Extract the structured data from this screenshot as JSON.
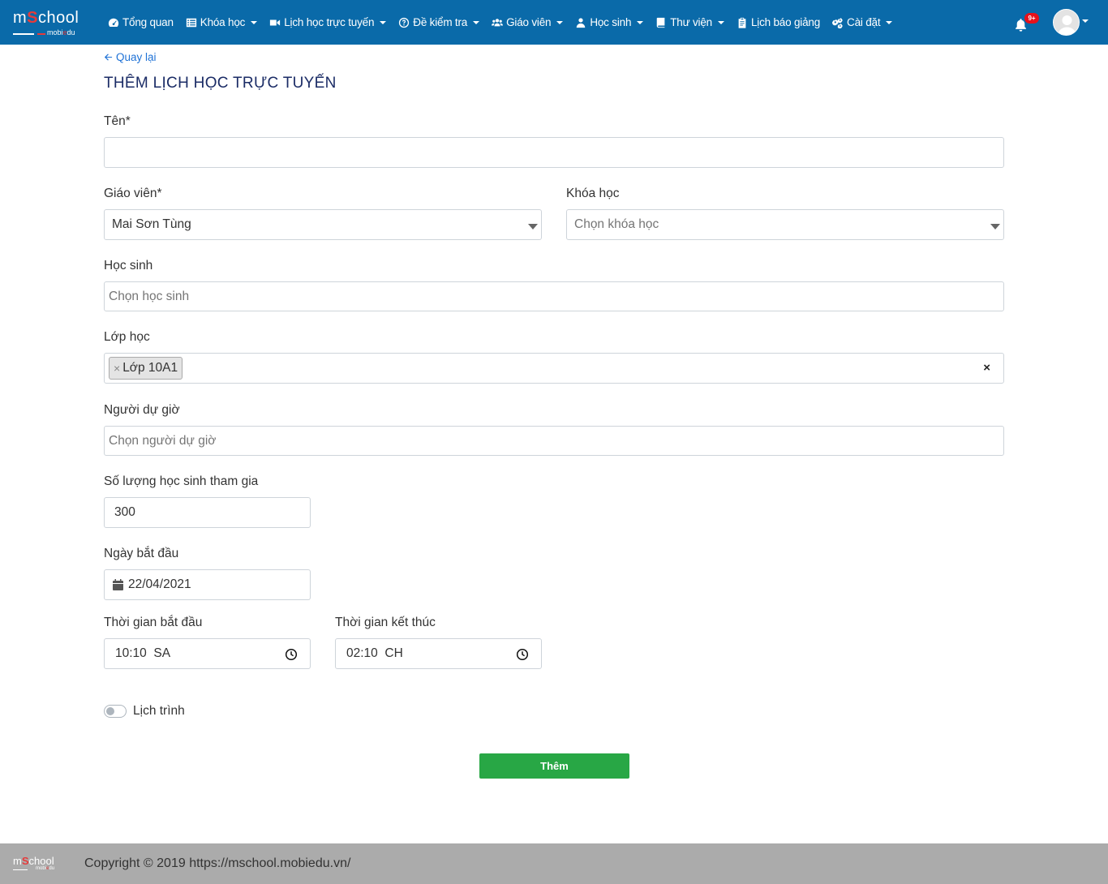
{
  "nav": {
    "logo": {
      "pre": "m",
      "s": "S",
      "post": "chool",
      "sub_pre": "mobi",
      "sub_post": "du"
    },
    "items": [
      {
        "label": "Tổng quan",
        "icon": "dashboard-icon",
        "dropdown": false
      },
      {
        "label": "Khóa học",
        "icon": "list-icon",
        "dropdown": true
      },
      {
        "label": "Lịch học trực tuyến",
        "icon": "video-icon",
        "dropdown": true
      },
      {
        "label": "Đề kiểm tra",
        "icon": "question-circle-icon",
        "dropdown": true
      },
      {
        "label": "Giáo viên",
        "icon": "users-icon",
        "dropdown": true
      },
      {
        "label": "Học sinh",
        "icon": "user-icon",
        "dropdown": true
      },
      {
        "label": "Thư viện",
        "icon": "book-icon",
        "dropdown": true
      },
      {
        "label": "Lịch báo giảng",
        "icon": "clipboard-icon",
        "dropdown": false
      },
      {
        "label": "Cài đặt",
        "icon": "gears-icon",
        "dropdown": true
      }
    ],
    "notification_badge": "9+"
  },
  "page": {
    "back_label": "Quay lại",
    "title": "THÊM LỊCH HỌC TRỰC TUYẾN"
  },
  "form": {
    "name": {
      "label": "Tên*",
      "value": ""
    },
    "teacher": {
      "label": "Giáo viên*",
      "value": "Mai Sơn Tùng"
    },
    "course": {
      "label": "Khóa học",
      "placeholder": "Chọn khóa học"
    },
    "student": {
      "label": "Học sinh",
      "placeholder": "Chọn học sinh"
    },
    "class": {
      "label": "Lớp học",
      "tags": [
        "Lớp 10A1"
      ],
      "tag_remove": "×",
      "clear": "×"
    },
    "observer": {
      "label": "Người dự giờ",
      "placeholder": "Chọn người dự giờ"
    },
    "count": {
      "label": "Số lượng học sinh tham gia",
      "value": "300"
    },
    "start_date": {
      "label": "Ngày bắt đầu",
      "value": "22/04/2021"
    },
    "start_time": {
      "label": "Thời gian bắt đầu",
      "value": "10:10  SA"
    },
    "end_time": {
      "label": "Thời gian kết thúc",
      "value": "02:10  CH"
    },
    "schedule": {
      "label": "Lịch trình",
      "enabled": false
    },
    "submit_label": "Thêm"
  },
  "footer": {
    "copyright": "Copyright © 2019 https://mschool.mobiedu.vn/"
  },
  "colors": {
    "navbar": "#0a6aa9",
    "title": "#1b2c66",
    "link": "#1f72d6",
    "submit": "#28a745",
    "footer": "#ababab",
    "badge": "#e6111b"
  }
}
